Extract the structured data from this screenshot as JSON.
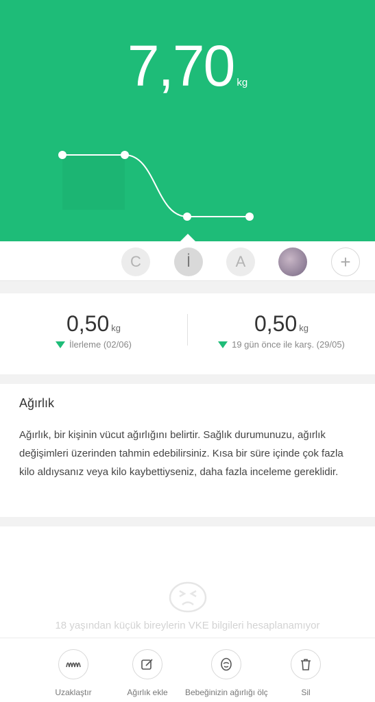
{
  "weight": {
    "value": "7,70",
    "unit": "kg"
  },
  "chart_data": {
    "type": "line",
    "x": [
      1,
      2,
      3,
      4
    ],
    "values": [
      8.2,
      8.2,
      7.7,
      7.7
    ],
    "title": "",
    "xlabel": "",
    "ylabel": ""
  },
  "profiles": [
    {
      "label": "C"
    },
    {
      "label": "İ"
    },
    {
      "label": "A"
    },
    {
      "label": ""
    },
    {
      "label": "+"
    }
  ],
  "stats": {
    "left": {
      "value": "0,50",
      "unit": "kg",
      "label": "İlerleme (02/06)"
    },
    "right": {
      "value": "0,50",
      "unit": "kg",
      "label": "19 gün önce ile karş. (29/05)"
    }
  },
  "info": {
    "title": "Ağırlık",
    "body": "Ağırlık, bir kişinin vücut ağırlığını belirtir. Sağlık durumunuzu, ağırlık değişimleri üzerinden tahmin edebilirsiniz. Kısa bir süre içinde çok fazla kilo aldıysanız veya kilo kaybettiyseniz, daha fazla inceleme gereklidir."
  },
  "empty_state": {
    "message": "18 yaşından küçük bireylerin VKE bilgileri hesaplanamıyor"
  },
  "actions": [
    {
      "label": "Uzaklaştır"
    },
    {
      "label": "Ağırlık ekle"
    },
    {
      "label": "Bebeğinizin ağırlığı ölçme"
    },
    {
      "label": "Sil"
    }
  ],
  "colors": {
    "accent": "#1ebc78"
  }
}
